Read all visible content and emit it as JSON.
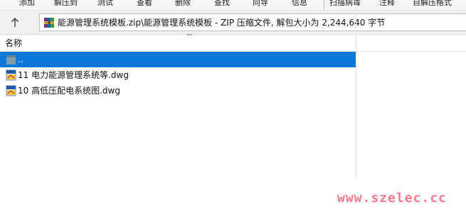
{
  "toolbar": {
    "buttons": [
      "添加",
      "解压到",
      "测试",
      "查看",
      "删除",
      "查找",
      "向导",
      "信息",
      "扫描病毒",
      "注释",
      "自解压格式"
    ]
  },
  "address": {
    "path": "能源管理系统模板.zip\\能源管理系统模板 - ZIP 压缩文件, 解包大小为 2,244,640 字节"
  },
  "list": {
    "column_name": "名称",
    "rows": [
      {
        "label": "..",
        "icon": "folder-up-icon",
        "selected": true
      },
      {
        "label": "11 电力能源管理系统等.dwg",
        "icon": "dwg-file-icon",
        "selected": false
      },
      {
        "label": "10 高低压配电系统图.dwg",
        "icon": "dwg-file-icon",
        "selected": false
      }
    ]
  },
  "watermark": "www.szelec.cc",
  "colors": {
    "selection": "#0a78d7",
    "watermark": "#f17a8c"
  }
}
